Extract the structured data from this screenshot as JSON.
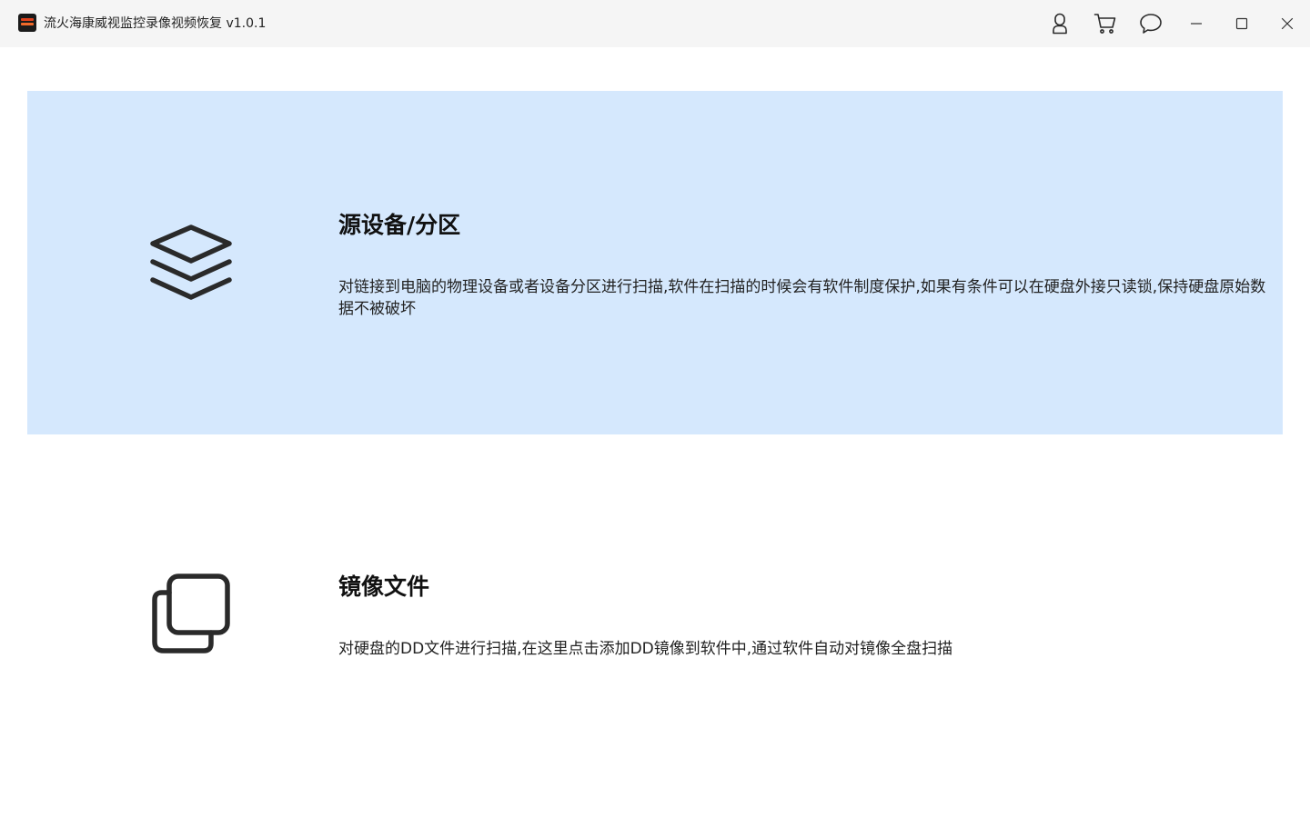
{
  "window": {
    "title": "流火海康威视监控录像视频恢复 v1.0.1",
    "controls": {
      "user": "user-icon",
      "cart": "cart-icon",
      "feedback": "chat-bubble-icon",
      "minimize": "minimize-icon",
      "maximize": "maximize-icon",
      "close": "close-icon"
    }
  },
  "options": [
    {
      "icon": "layers-icon",
      "title": "源设备/分区",
      "description": "对链接到电脑的物理设备或者设备分区进行扫描,软件在扫描的时候会有软件制度保护,如果有条件可以在硬盘外接只读锁,保持硬盘原始数据不被破坏",
      "selected": true
    },
    {
      "icon": "copy-icon",
      "title": "镜像文件",
      "description": "对硬盘的DD文件进行扫描,在这里点击添加DD镜像到软件中,通过软件自动对镜像全盘扫描",
      "selected": false
    }
  ],
  "colors": {
    "titlebar_bg": "#f5f5f5",
    "selected_card_bg": "#d5e8fd",
    "icon_stroke": "#2a2a2a"
  }
}
